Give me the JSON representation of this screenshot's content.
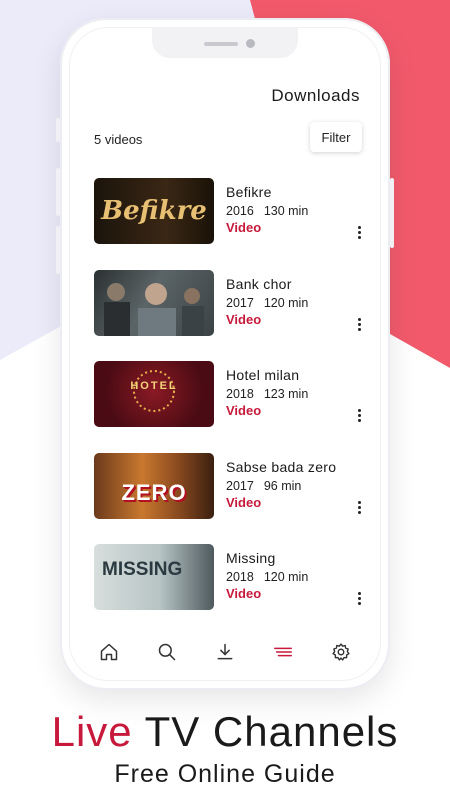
{
  "header": {
    "title": "Downloads"
  },
  "summary": {
    "count": "5 videos",
    "filter_label": "Filter"
  },
  "videos": [
    {
      "title": "Befikre",
      "year": "2016",
      "duration": "130 min",
      "type": "Video",
      "thumb_text": "Befikre"
    },
    {
      "title": "Bank chor",
      "year": "2017",
      "duration": "120 min",
      "type": "Video",
      "thumb_text": ""
    },
    {
      "title": "Hotel milan",
      "year": "2018",
      "duration": "123 min",
      "type": "Video",
      "thumb_text": "HOTEL"
    },
    {
      "title": "Sabse bada zero",
      "year": "2017",
      "duration": "96 min",
      "type": "Video",
      "thumb_text": "ZERO"
    },
    {
      "title": "Missing",
      "year": "2018",
      "duration": "120 min",
      "type": "Video",
      "thumb_text": "MISSING"
    }
  ],
  "nav": {
    "items": [
      "home-icon",
      "search-icon",
      "download-icon",
      "menu-icon",
      "gear-icon"
    ],
    "active": "menu-icon"
  },
  "promo": {
    "headline_accent": "Live",
    "headline_rest": "TV Channels",
    "subline": "Free Online Guide"
  },
  "colors": {
    "accent": "#c7193b",
    "coral": "#f25a6c",
    "lavender": "#e8e9fb"
  }
}
